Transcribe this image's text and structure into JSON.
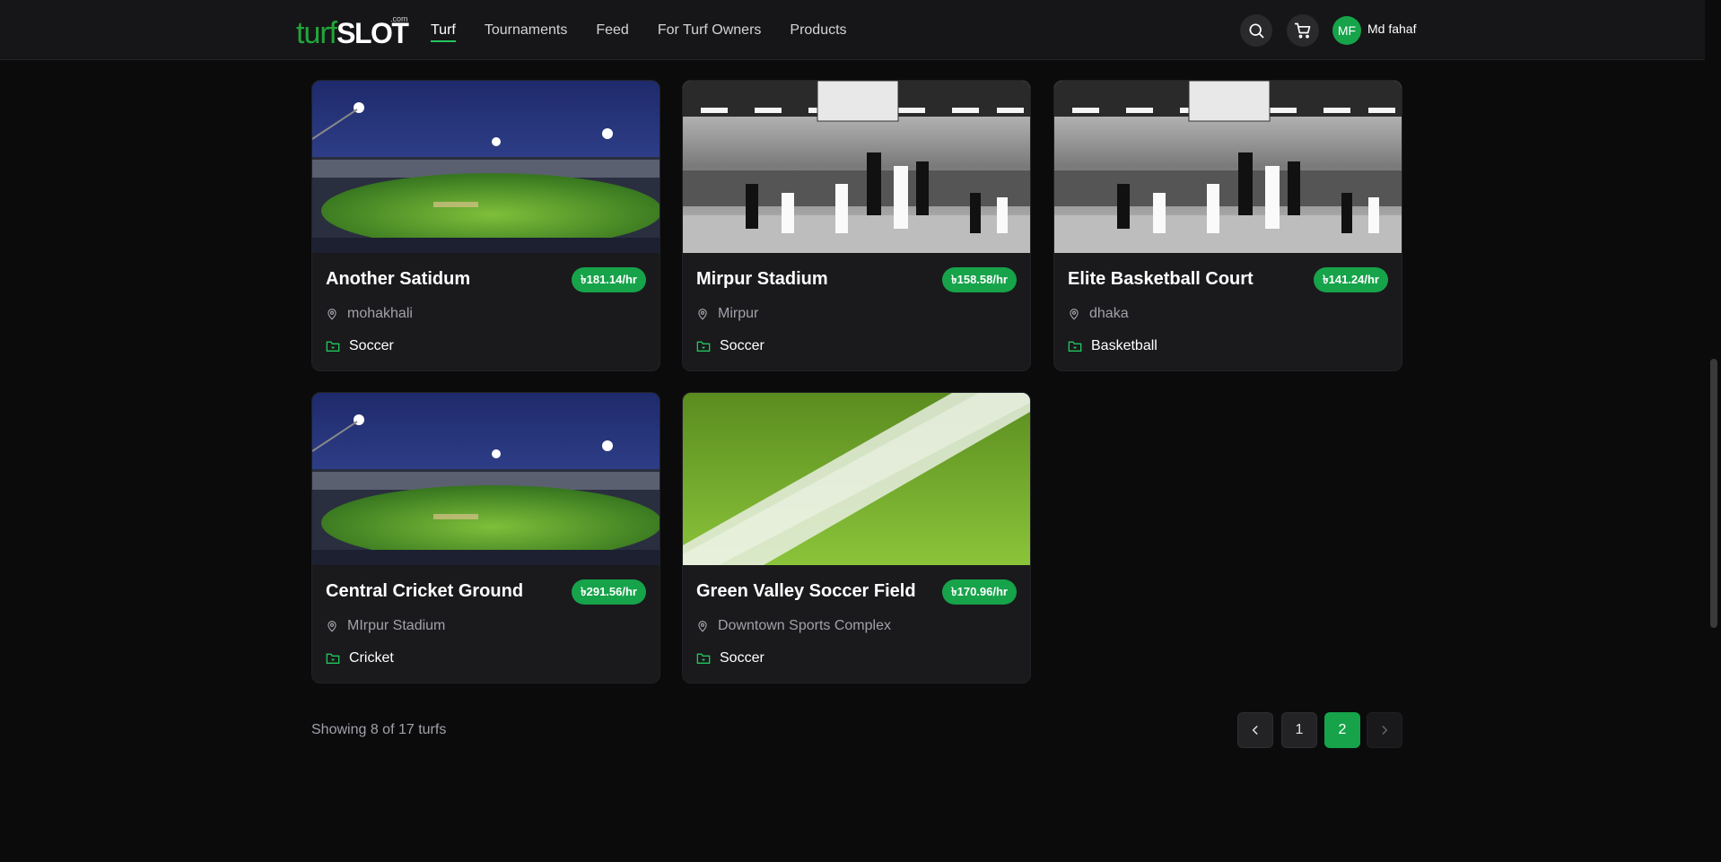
{
  "header": {
    "logo": {
      "turf": "turf",
      "slot": "SLOT",
      "com": ".com"
    },
    "nav": [
      {
        "label": "Turf",
        "active": true
      },
      {
        "label": "Tournaments",
        "active": false
      },
      {
        "label": "Feed",
        "active": false
      },
      {
        "label": "For Turf Owners",
        "active": false
      },
      {
        "label": "Products",
        "active": false
      }
    ],
    "search_icon": "search-icon",
    "cart_icon": "cart-icon",
    "avatar_initials": "MF",
    "username": "Md fahaf"
  },
  "turfs": [
    {
      "name": "Another Satidum",
      "price": "৳181.14/hr",
      "location": "mohakhali",
      "sport": "Soccer",
      "image": "stadium-night"
    },
    {
      "name": "Mirpur Stadium",
      "price": "৳158.58/hr",
      "location": "Mirpur",
      "sport": "Soccer",
      "image": "basketball-bw"
    },
    {
      "name": "Elite Basketball Court",
      "price": "৳141.24/hr",
      "location": "dhaka",
      "sport": "Basketball",
      "image": "basketball-bw"
    },
    {
      "name": "Central Cricket Ground",
      "price": "৳291.56/hr",
      "location": "MIrpur Stadium",
      "sport": "Cricket",
      "image": "stadium-night"
    },
    {
      "name": "Green Valley Soccer Field",
      "price": "৳170.96/hr",
      "location": "Downtown Sports Complex",
      "sport": "Soccer",
      "image": "grass-line"
    }
  ],
  "pagination": {
    "showing": "Showing 8 of 17 turfs",
    "pages": [
      "1",
      "2"
    ],
    "current": "2"
  },
  "colors": {
    "accent": "#16a34a",
    "background": "#0b0b0c",
    "card": "#1a1a1c"
  }
}
